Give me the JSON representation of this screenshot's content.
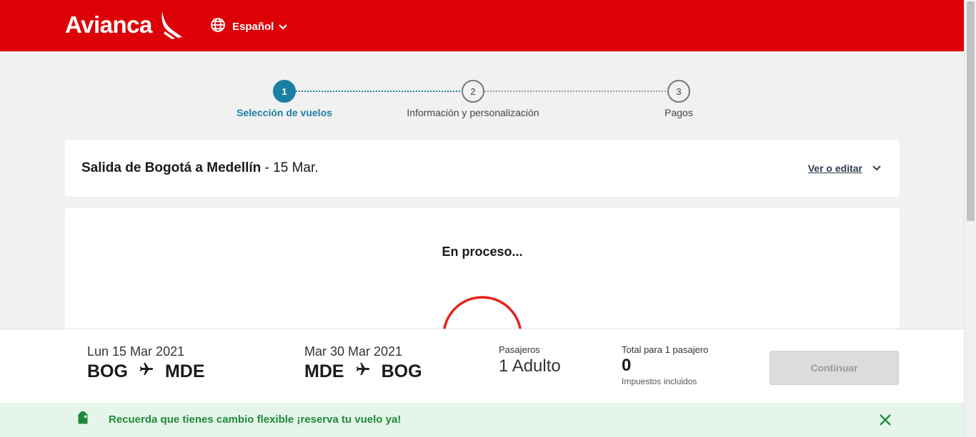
{
  "header": {
    "logo_text": "Avianca",
    "language": "Español",
    "brand_color": "#de0007"
  },
  "stepper": {
    "steps": [
      {
        "number": "1",
        "label": "Selección de vuelos",
        "state": "active"
      },
      {
        "number": "2",
        "label": "Información y personalización",
        "state": "pending"
      },
      {
        "number": "3",
        "label": "Pagos",
        "state": "pending"
      }
    ],
    "active_color": "#1b7fa3"
  },
  "route": {
    "title": "Salida de Bogotá a Medellín",
    "date": " - 15 Mar.",
    "edit_label": "Ver o editar"
  },
  "process": {
    "title": "En proceso..."
  },
  "summary": {
    "outbound": {
      "date": "Lun 15 Mar 2021",
      "origin": "BOG",
      "destination": "MDE"
    },
    "return": {
      "date": "Mar 30 Mar 2021",
      "origin": "MDE",
      "destination": "BOG"
    },
    "passengers_label": "Pasajeros",
    "passengers_value": "1 Adulto",
    "total_label": "Total para 1 pasajero",
    "total_value": "0",
    "tax_note": "Impuestos incluidos",
    "continue_label": "Continuar"
  },
  "banner": {
    "text": "Recuerda que tienes cambio flexible ¡reserva tu vuelo ya!",
    "color": "#1f8a3b"
  },
  "icons": [
    "globe-icon",
    "chevron-down-icon",
    "plane-icon",
    "tag-icon",
    "close-icon",
    "spinner-icon"
  ]
}
